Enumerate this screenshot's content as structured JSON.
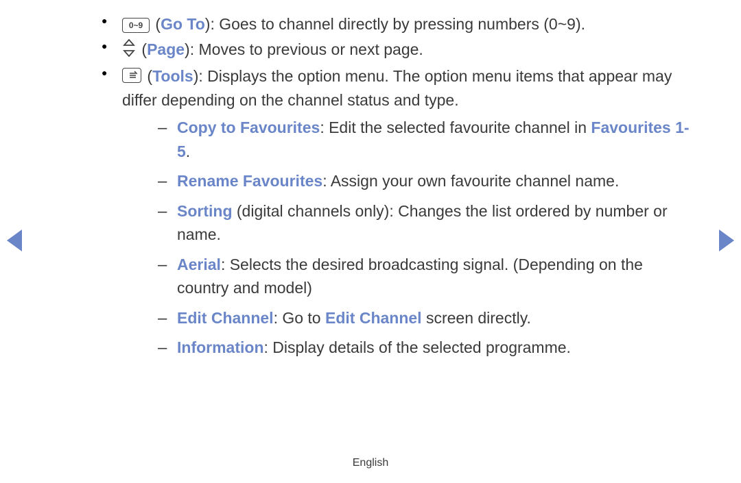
{
  "items": [
    {
      "icon": {
        "type": "numbox",
        "label": "0~9"
      },
      "title": "Go To",
      "desc": ": Goes to channel directly by pressing numbers (0~9)."
    },
    {
      "icon": {
        "type": "updown"
      },
      "title": "Page",
      "desc": ": Moves to previous or next page."
    },
    {
      "icon": {
        "type": "tools"
      },
      "title": "Tools",
      "desc": ": Displays the option menu. The option menu items that appear may differ depending on the channel status and type.",
      "sub": [
        {
          "title": "Copy to Favourites",
          "segments": [
            ": Edit the selected favourite channel in ",
            {
              "blue": "Favourites 1-5"
            },
            "."
          ]
        },
        {
          "title": "Rename Favourites",
          "segments": [
            ": Assign your own favourite channel name."
          ]
        },
        {
          "title": "Sorting",
          "segments": [
            " (digital channels only): Changes the list ordered by number or name."
          ]
        },
        {
          "title": "Aerial",
          "segments": [
            ": Selects the desired broadcasting signal. (Depending on the country and model)"
          ]
        },
        {
          "title": "Edit Channel",
          "segments": [
            ": Go to ",
            {
              "blue": "Edit Channel"
            },
            " screen directly."
          ]
        },
        {
          "title": "Information",
          "segments": [
            ": Display details of the selected programme."
          ]
        }
      ]
    }
  ],
  "footer": "English"
}
